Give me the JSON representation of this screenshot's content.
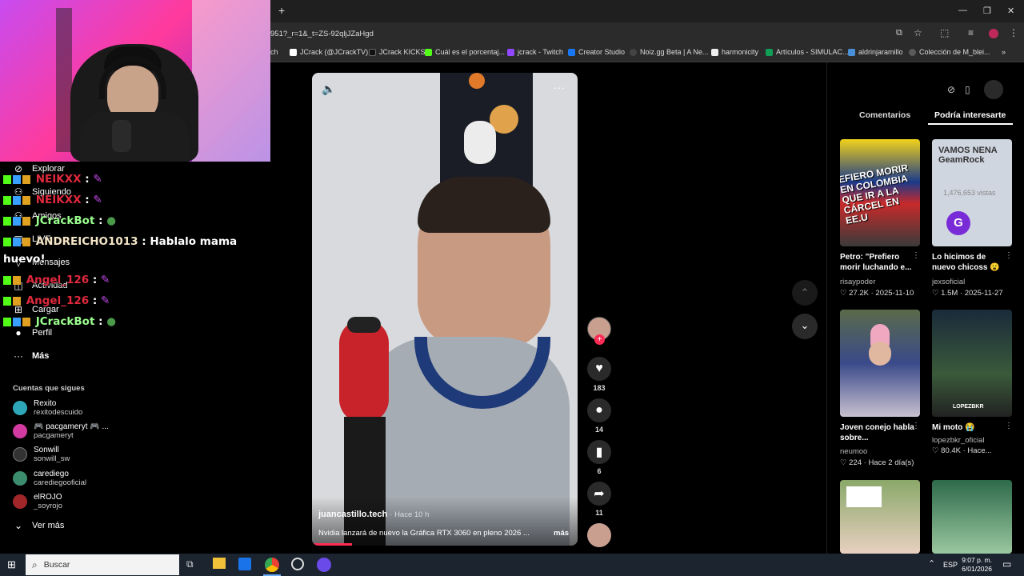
{
  "browser": {
    "url": "951?_r=1&_t=ZS-92qljJZaHgd",
    "new_tab": "+",
    "bookmarks": [
      {
        "label": "ch",
        "color": "#888888"
      },
      {
        "label": "JCrack (@JCrackTV)...",
        "color": "#ffffff"
      },
      {
        "label": "JCrack KICKS",
        "color": "#111111"
      },
      {
        "label": "Cuál es el porcentaj...",
        "color": "#53fc18"
      },
      {
        "label": "jcrack - Twitch",
        "color": "#9146ff"
      },
      {
        "label": "Creator Studio",
        "color": "#1877f2"
      },
      {
        "label": "Noiz.gg Beta | A Ne...",
        "color": "#333333"
      },
      {
        "label": "harmonicity",
        "color": "#eeeeee"
      },
      {
        "label": "Artículos - SIMULAC...",
        "color": "#0f9d58"
      },
      {
        "label": "aldrinjaramillo",
        "color": "#4a90d9"
      },
      {
        "label": "Colección de M_blei...",
        "color": "#5a5a5a"
      }
    ]
  },
  "nav": {
    "items": [
      {
        "label": "Explorar",
        "icon": "compass-icon"
      },
      {
        "label": "Siguiendo",
        "icon": "following-icon"
      },
      {
        "label": "Amigos",
        "icon": "friends-icon"
      },
      {
        "label": "LIVE",
        "icon": "live-icon"
      },
      {
        "label": "Mensajes",
        "icon": "message-icon"
      },
      {
        "label": "Actividad",
        "icon": "activity-icon"
      },
      {
        "label": "Cargar",
        "icon": "upload-icon"
      },
      {
        "label": "Perfil",
        "icon": "profile-icon"
      },
      {
        "label": "Más",
        "icon": "more-icon"
      }
    ],
    "following_title": "Cuentas que sigues",
    "following": [
      {
        "name": "Rexito",
        "user": "rexitodescuido",
        "color": "#2ea7b8"
      },
      {
        "name": "🎮 pacgameryt 🎮 ...",
        "user": "pacgameryt",
        "color": "#d23aa0"
      },
      {
        "name": "Sonwill",
        "user": "sonwill_sw",
        "color": "#333333"
      },
      {
        "name": "carediego",
        "user": "carediegooficial",
        "color": "#3c8c6e"
      },
      {
        "name": "elROJO",
        "user": "_soyrojo",
        "color": "#a0262a"
      }
    ],
    "see_more": "Ver más"
  },
  "chat": [
    {
      "user": "NEIKXX",
      "msg": "",
      "color": "#e0293d"
    },
    {
      "user": "NEIKXX",
      "msg": "",
      "color": "#e0293d"
    },
    {
      "user": "JCrackBot",
      "msg": "",
      "color": "#9bff8f"
    },
    {
      "user": "ANDREICHO1013",
      "msg": "Hablalo mama",
      "color": "#f5e6c8"
    },
    {
      "user": "huevo!",
      "msg": "",
      "color": "#ffffff"
    },
    {
      "user": "Angel_126",
      "msg": "",
      "color": "#e0293d"
    },
    {
      "user": "Angel_126",
      "msg": "",
      "color": "#e0293d"
    },
    {
      "user": "JCrackBot",
      "msg": "",
      "color": "#9bff8f"
    }
  ],
  "video": {
    "author": "juancastillo.tech",
    "time": "· Hace 10 h",
    "caption": "Nvidia lanzará de nuevo la Gráfica RTX 3060 en pleno 2026 ...",
    "more": "más",
    "likes": "183",
    "comments": "14",
    "saves": "6",
    "shares": "11"
  },
  "right": {
    "tabs": [
      "Comentarios",
      "Podría interesarte"
    ],
    "cards": [
      {
        "title": "Petro: \"Prefiero morir luchando e...",
        "user": "risaypoder",
        "stats": "♡ 27.2K · 2025-11-10",
        "overlay": "EFIERO MORIR EN COLOMBIA QUE IR A LA CÁRCEL EN EE.U",
        "bg": "#2b4a8a"
      },
      {
        "title": "Lo hicimos de nuevo chicoss 😮",
        "user": "jexsoficial",
        "stats": "♡ 1.5M · 2025-11-27",
        "overlay": "VAMOS NENA GeamRock",
        "bg": "#cfd6e0"
      },
      {
        "title": "Joven conejo habla sobre...",
        "user": "neumoo",
        "stats": "♡ 224 · Hace 2 día(s)",
        "overlay": "",
        "bg": "#6a5a7a"
      },
      {
        "title": "Mi moto 😭",
        "user": "lopezbkr_oficial",
        "stats": "♡ 80.4K · Hace...",
        "overlay": "LOPEZBKR",
        "bg": "#2a3a2a"
      },
      {
        "title": "",
        "user": "",
        "stats": "",
        "overlay": "",
        "bg": "#6a8a5a"
      },
      {
        "title": "",
        "user": "",
        "stats": "",
        "overlay": "",
        "bg": "#2d6a4a"
      }
    ],
    "card_views": "1,476,653 vistas"
  },
  "taskbar": {
    "search": "Buscar",
    "lang": "ESP",
    "time": "9:07 p. m.",
    "date": "6/01/2026"
  },
  "colors": {
    "accent": "#fe2c55",
    "chrome_bg": "#2b2b2b"
  }
}
